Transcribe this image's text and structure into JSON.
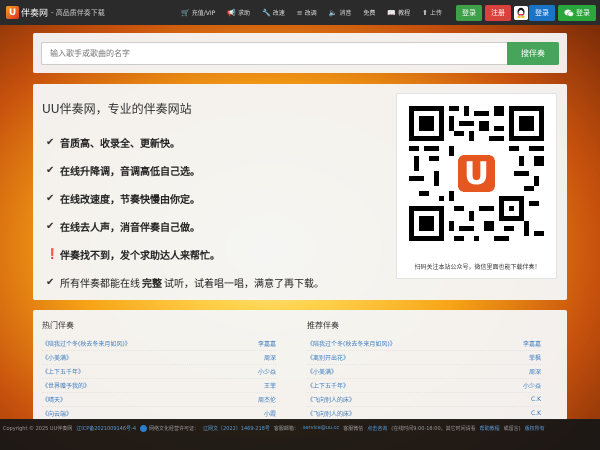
{
  "header": {
    "logo_mark": "U",
    "logo_text": "伴奏网",
    "logo_sub": "- 高品质伴奏下载",
    "nav": [
      {
        "icon": "cart-icon",
        "glyph": "🛒",
        "label": "充值/VIP"
      },
      {
        "icon": "megaphone-icon",
        "glyph": "📢",
        "label": "求助"
      },
      {
        "icon": "wrench-icon",
        "glyph": "🔧",
        "label": "改速"
      },
      {
        "icon": "equalizer-icon",
        "glyph": "≡",
        "label": "改调"
      },
      {
        "icon": "mute-icon",
        "glyph": "🔈",
        "label": "消音"
      },
      {
        "icon": "gift-icon",
        "glyph": "",
        "label": "免费"
      },
      {
        "icon": "book-icon",
        "glyph": "📖",
        "label": "教程"
      },
      {
        "icon": "upload-icon",
        "glyph": "⬆",
        "label": "上传"
      }
    ],
    "login_label": "登录",
    "register_label": "注册",
    "qq_login_label": "登录",
    "wechat_login_label": "登录"
  },
  "search": {
    "placeholder": "输入歌手或歌曲的名字",
    "button_label": "搜伴奏"
  },
  "intro": {
    "title": "UU伴奏网，专业的伴奏网站",
    "features": [
      "音质高、收录全、更新快。",
      "在线升降调，音调高低自己选。",
      "在线改速度，节奏快慢由你定。",
      "在线去人声，消音伴奏自己做。"
    ],
    "help_text": "伴奏找不到，发个求助达人来帮忙。",
    "note_before": "所有伴奏都能在线",
    "note_strong": "完整",
    "note_after": "试听，试着唱一唱，满意了再下载。",
    "qr_caption": "扫码关注本站公众号，微信里面也能下载伴奏！"
  },
  "hot_list": {
    "title": "热门伴奏",
    "items": [
      {
        "song": "《陪我过个冬(秋去冬来月如风)》",
        "singer": "李嘉嘉"
      },
      {
        "song": "《小美满》",
        "singer": "周深"
      },
      {
        "song": "《上下五千年》",
        "singer": "小少焱"
      },
      {
        "song": "《世界赠予我的》",
        "singer": "王菲"
      },
      {
        "song": "《晴天》",
        "singer": "周杰伦"
      },
      {
        "song": "《向云端》",
        "singer": "小霞"
      }
    ]
  },
  "rec_list": {
    "title": "推荐伴奏",
    "items": [
      {
        "song": "《陪我过个冬(秋去冬来月如风)》",
        "singer": "李嘉嘉"
      },
      {
        "song": "《离别开出花》",
        "singer": "菲枫"
      },
      {
        "song": "《小美满》",
        "singer": "周深"
      },
      {
        "song": "《上下五千年》",
        "singer": "小少焱"
      },
      {
        "song": "《飞向别人的床》",
        "singer": "C.K"
      },
      {
        "song": "《飞向别人的床》",
        "singer": "C.K"
      }
    ]
  },
  "footer": {
    "copyright": "Copyright © 2025 UU伴奏网",
    "icp": "辽ICP备2021009146号-4",
    "culture": "网络文化经营许可证：",
    "culture_no": "辽网文〔2022〕1469-218号",
    "email_label": "客服邮箱：",
    "email": "service@uu.cc",
    "service_label": "客服微信",
    "online_label": "点击咨询",
    "hours": "(在线时间9:00-18:00，其它时间请看",
    "help_link": "帮助教程",
    "hours_end": "或留言)",
    "rights": "版权所有"
  },
  "colors": {
    "accent_green": "#46a55a",
    "link_blue": "#3a7bbf",
    "register_red": "#d9423c",
    "qq_blue": "#1b73c6"
  }
}
